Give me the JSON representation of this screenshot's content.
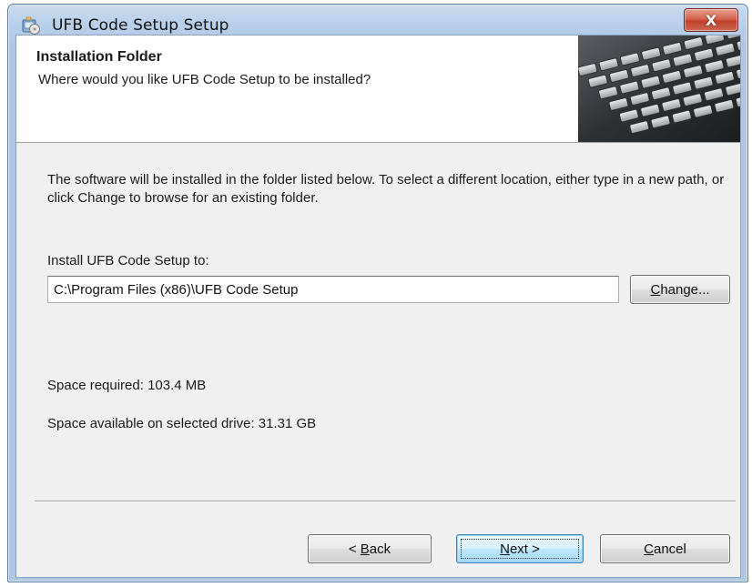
{
  "window": {
    "title": "UFB Code Setup Setup",
    "close_label": "X"
  },
  "banner": {
    "title": "Installation Folder",
    "subtitle": "Where would you like UFB Code Setup to be installed?"
  },
  "content": {
    "description": "The software will be installed in the folder listed below. To select a different location, either type in a new path, or click Change to browse for an existing folder.",
    "install_label": "Install UFB Code Setup to:",
    "install_path": "C:\\Program Files (x86)\\UFB Code Setup",
    "change_label_mnemonic": "C",
    "change_label_rest": "hange...",
    "space_required": "Space required: 103.4 MB",
    "space_available": "Space available on selected drive: 31.31 GB"
  },
  "footer": {
    "back_prefix": "< ",
    "back_mnemonic": "B",
    "back_rest": "ack",
    "next_mnemonic": "N",
    "next_rest": "ext >",
    "cancel_mnemonic": "C",
    "cancel_rest": "ancel"
  },
  "icons": {
    "app": "installer-icon",
    "banner": "keyboard-image",
    "close": "close-icon"
  },
  "colors": {
    "title_bar": "#b7cfe9",
    "close_button": "#c0402b",
    "dialog_background": "#f0f0f0",
    "banner_background": "#ffffff",
    "default_button_border": "#3c7fb1"
  }
}
